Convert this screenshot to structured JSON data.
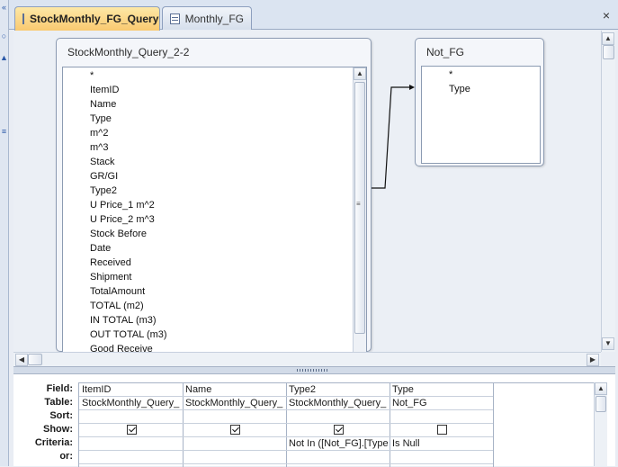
{
  "tabs": [
    {
      "label": "StockMonthly_FG_Query",
      "active": true,
      "icon": "query-icon"
    },
    {
      "label": "Monthly_FG",
      "active": false,
      "icon": "table-icon"
    }
  ],
  "close_icon": "×",
  "tables": {
    "source": {
      "title": "StockMonthly_Query_2-2",
      "fields": [
        "*",
        "ItemID",
        "Name",
        "Type",
        "m^2",
        "m^3",
        "Stack",
        "GR/GI",
        "Type2",
        "U Price_1 m^2",
        "U Price_2 m^3",
        "Stock Before",
        "Date",
        "Received",
        "Shipment",
        "TotalAmount",
        "TOTAL (m2)",
        "IN TOTAL (m3)",
        "OUT TOTAL (m3)",
        "Good Receive"
      ]
    },
    "lookup": {
      "title": "Not_FG",
      "fields": [
        "*",
        "Type"
      ]
    }
  },
  "grid": {
    "row_labels": [
      "Field:",
      "Table:",
      "Sort:",
      "Show:",
      "Criteria:",
      "or:"
    ],
    "columns": [
      {
        "field": "ItemID",
        "table": "StockMonthly_Query_",
        "sort": "",
        "show": true,
        "criteria": "",
        "or": ""
      },
      {
        "field": "Name",
        "table": "StockMonthly_Query_",
        "sort": "",
        "show": true,
        "criteria": "",
        "or": ""
      },
      {
        "field": "Type2",
        "table": "StockMonthly_Query_",
        "sort": "",
        "show": true,
        "criteria": "Not In ([Not_FG].[Type",
        "or": ""
      },
      {
        "field": "Type",
        "table": "Not_FG",
        "sort": "",
        "show": false,
        "criteria": "Is Null",
        "or": ""
      }
    ]
  },
  "colors": {
    "active_tab": "#f9c970",
    "accent": "#2a58a8",
    "border": "#8c9bb2"
  }
}
